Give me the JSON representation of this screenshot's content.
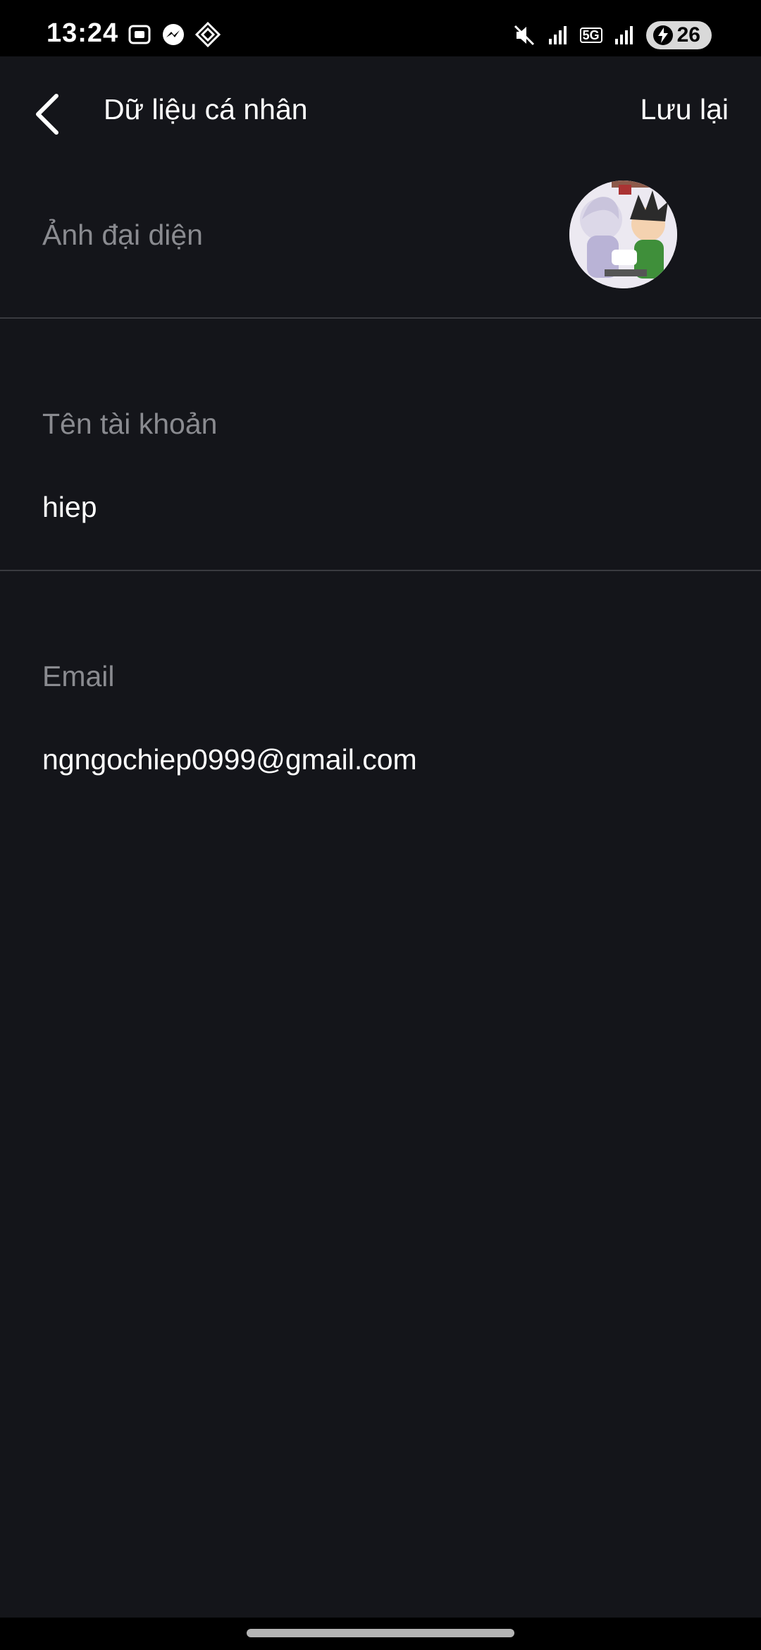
{
  "status_bar": {
    "time": "13:24",
    "network": "5G",
    "battery": "26"
  },
  "header": {
    "title": "Dữ liệu cá nhân",
    "save_label": "Lưu lại"
  },
  "avatar_row": {
    "label": "Ảnh đại diện"
  },
  "username": {
    "label": "Tên tài khoản",
    "value": "hiep"
  },
  "email": {
    "label": "Email",
    "value": "ngngochiep0999@gmail.com"
  },
  "colors": {
    "background": "#14151a",
    "status_bar": "#000000",
    "label": "#8a8b90",
    "text": "#ffffff",
    "divider": "#3a3b40"
  },
  "icons": [
    "back-arrow-icon",
    "screenshot-icon",
    "messenger-icon",
    "app-diamond-icon",
    "mute-icon",
    "signal-icon",
    "battery-charging-icon"
  ]
}
